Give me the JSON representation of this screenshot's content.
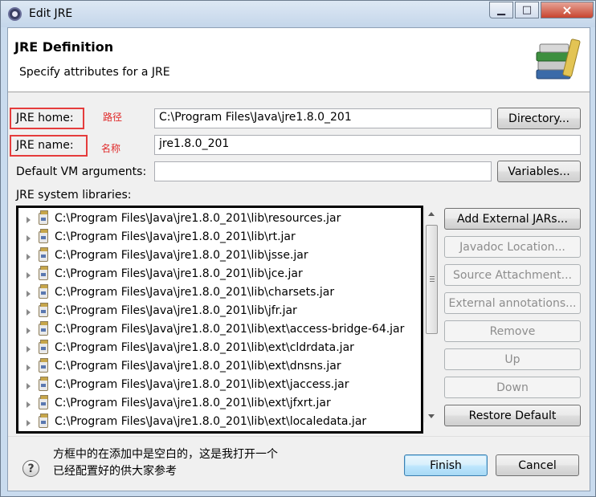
{
  "window": {
    "title": "Edit JRE",
    "close_glyph": "×",
    "min_glyph": "▁",
    "max_glyph": "□"
  },
  "header": {
    "title": "JRE Definition",
    "subtitle": "Specify attributes for a JRE"
  },
  "form": {
    "jre_home_label": "JRE home:",
    "jre_home_annotation": "路径",
    "jre_home_value": "C:\\Program Files\\Java\\jre1.8.0_201",
    "directory_button": "Directory...",
    "jre_name_label": "JRE name:",
    "jre_name_annotation": "名称",
    "jre_name_value": "jre1.8.0_201",
    "vm_args_label": "Default VM arguments:",
    "vm_args_value": "",
    "variables_button": "Variables...",
    "libraries_label": "JRE system libraries:"
  },
  "libraries": [
    "C:\\Program Files\\Java\\jre1.8.0_201\\lib\\resources.jar",
    "C:\\Program Files\\Java\\jre1.8.0_201\\lib\\rt.jar",
    "C:\\Program Files\\Java\\jre1.8.0_201\\lib\\jsse.jar",
    "C:\\Program Files\\Java\\jre1.8.0_201\\lib\\jce.jar",
    "C:\\Program Files\\Java\\jre1.8.0_201\\lib\\charsets.jar",
    "C:\\Program Files\\Java\\jre1.8.0_201\\lib\\jfr.jar",
    "C:\\Program Files\\Java\\jre1.8.0_201\\lib\\ext\\access-bridge-64.jar",
    "C:\\Program Files\\Java\\jre1.8.0_201\\lib\\ext\\cldrdata.jar",
    "C:\\Program Files\\Java\\jre1.8.0_201\\lib\\ext\\dnsns.jar",
    "C:\\Program Files\\Java\\jre1.8.0_201\\lib\\ext\\jaccess.jar",
    "C:\\Program Files\\Java\\jre1.8.0_201\\lib\\ext\\jfxrt.jar",
    "C:\\Program Files\\Java\\jre1.8.0_201\\lib\\ext\\localedata.jar"
  ],
  "side_buttons": {
    "add_external_jars": "Add External JARs...",
    "javadoc_location": "Javadoc Location...",
    "source_attachment": "Source Attachment...",
    "external_annotations": "External annotations...",
    "remove": "Remove",
    "up": "Up",
    "down": "Down",
    "restore_default": "Restore Default"
  },
  "footer": {
    "help_glyph": "?",
    "note_line1": "方框中的在添加中是空白的，这是我打开一个",
    "note_line2": "已经配置好的供大家参考",
    "finish_button": "Finish",
    "cancel_button": "Cancel"
  },
  "colors": {
    "annotation_red": "#e02a2a",
    "highlight_box": "#e53c3c"
  }
}
